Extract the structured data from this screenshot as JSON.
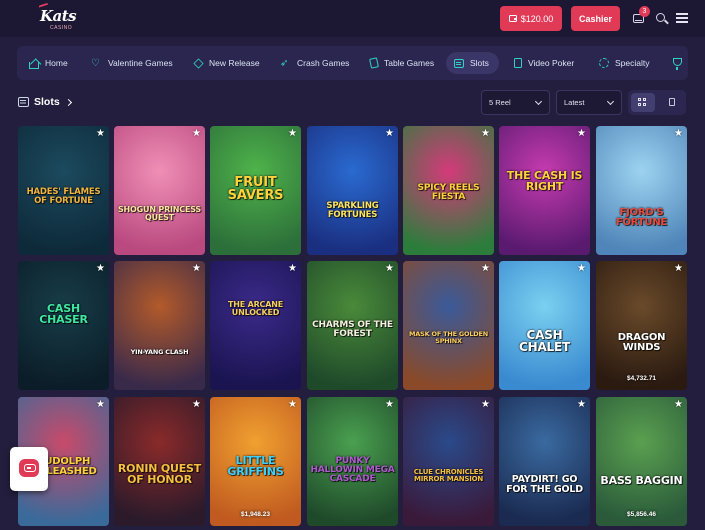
{
  "header": {
    "logo_text": "Kats",
    "logo_subtext": "CASINO",
    "balance_label": "$120.00",
    "cashier_label": "Cashier",
    "notification_count": "3"
  },
  "categories": [
    {
      "label": "Home",
      "icon": "home-icon"
    },
    {
      "label": "Valentine Games",
      "icon": "heart-icon"
    },
    {
      "label": "New Release",
      "icon": "diamond-icon"
    },
    {
      "label": "Crash Games",
      "icon": "rocket-icon"
    },
    {
      "label": "Table Games",
      "icon": "cards-icon"
    },
    {
      "label": "Slots",
      "icon": "slot-machine-icon",
      "active": true
    },
    {
      "label": "Video Poker",
      "icon": "poker-card-icon"
    },
    {
      "label": "Specialty",
      "icon": "chip-icon"
    }
  ],
  "section": {
    "title": "Slots",
    "reel_filter": "5 Reel",
    "sort_filter": "Latest"
  },
  "games": [
    {
      "title": "HADES' FLAMES OF FORTUNE",
      "jackpot": "",
      "bg": "#1c4a5e",
      "bg2": "#0d2a3a",
      "fg": "#f2b640"
    },
    {
      "title": "SHOGUN PRINCESS QUEST",
      "jackpot": "",
      "bg": "#f08fb6",
      "bg2": "#b9497f",
      "fg": "#ffe5a0"
    },
    {
      "title": "FRUIT SAVERS",
      "jackpot": "",
      "bg": "#4fb34a",
      "bg2": "#2c6f3a",
      "fg": "#ffd23c"
    },
    {
      "title": "SPARKLING FORTUNES",
      "jackpot": "",
      "bg": "#2a6ad0",
      "bg2": "#1a2f80",
      "fg": "#ffe45a"
    },
    {
      "title": "SPICY REELS FIESTA",
      "jackpot": "",
      "bg": "#d43a7a",
      "bg2": "#2c7d3c",
      "fg": "#ffd23c"
    },
    {
      "title": "THE CASH IS RIGHT",
      "jackpot": "",
      "bg": "#c63bb0",
      "bg2": "#5a1a70",
      "fg": "#ffd23c"
    },
    {
      "title": "FJORD'S FORTUNE",
      "jackpot": "",
      "bg": "#9dd3f0",
      "bg2": "#4f85b8",
      "fg": "#e84a3c"
    },
    {
      "title": "CASH CHASER",
      "jackpot": "",
      "bg": "#173d48",
      "bg2": "#0b1d28",
      "fg": "#3ee8a2"
    },
    {
      "title": "YIN-YANG CLASH",
      "jackpot": "",
      "bg": "#b35a2a",
      "bg2": "#3a2a4a",
      "fg": "#ffffff"
    },
    {
      "title": "THE ARCANE UNLOCKED",
      "jackpot": "",
      "bg": "#3b2a8a",
      "bg2": "#1a1450",
      "fg": "#f5d060"
    },
    {
      "title": "CHARMS OF THE FOREST",
      "jackpot": "",
      "bg": "#4a8a3a",
      "bg2": "#1f4a2a",
      "fg": "#f5f0e0"
    },
    {
      "title": "MASK OF THE GOLDEN SPHINX",
      "jackpot": "",
      "bg": "#3a5a9a",
      "bg2": "#8a4a2a",
      "fg": "#ffd060"
    },
    {
      "title": "CASH CHALET",
      "jackpot": "",
      "bg": "#7ad0f0",
      "bg2": "#3a8ad0",
      "fg": "#ffffff"
    },
    {
      "title": "DRAGON WINDS",
      "jackpot": "$4,732.71",
      "bg": "#6a4a2a",
      "bg2": "#2a1a10",
      "fg": "#ffffff"
    },
    {
      "title": "RUDOLPH UNLEASHED",
      "jackpot": "",
      "bg": "#c84a6a",
      "bg2": "#3a6a9a",
      "fg": "#ffd23c"
    },
    {
      "title": "RONIN QUEST OF HONOR",
      "jackpot": "",
      "bg": "#8a2a2a",
      "bg2": "#2a1a2a",
      "fg": "#f5c040"
    },
    {
      "title": "LITTLE GRIFFINS",
      "jackpot": "$1,948.23",
      "bg": "#f0a030",
      "bg2": "#c05a20",
      "fg": "#3ad0ff"
    },
    {
      "title": "PUNKY HALLOWIN MEGA CASCADE",
      "jackpot": "",
      "bg": "#4aa050",
      "bg2": "#1f4a2a",
      "fg": "#b05ad0"
    },
    {
      "title": "CLUE CHRONICLES MIRROR MANSION",
      "jackpot": "",
      "bg": "#2a4a8a",
      "bg2": "#3a1a3a",
      "fg": "#f5c040"
    },
    {
      "title": "PAYDIRT! GO FOR THE GOLD",
      "jackpot": "",
      "bg": "#3a6aa0",
      "bg2": "#1a2a50",
      "fg": "#ffffff"
    },
    {
      "title": "BASS BAGGIN",
      "jackpot": "$5,856.46",
      "bg": "#5aa050",
      "bg2": "#2a5a3a",
      "fg": "#ffffff"
    }
  ],
  "colors": {
    "accent": "#e03a57",
    "nav_icon": "#2fd3c4",
    "background": "#231e3d"
  },
  "icons": {
    "favorite": "star-icon",
    "chat": "chat-icon"
  }
}
